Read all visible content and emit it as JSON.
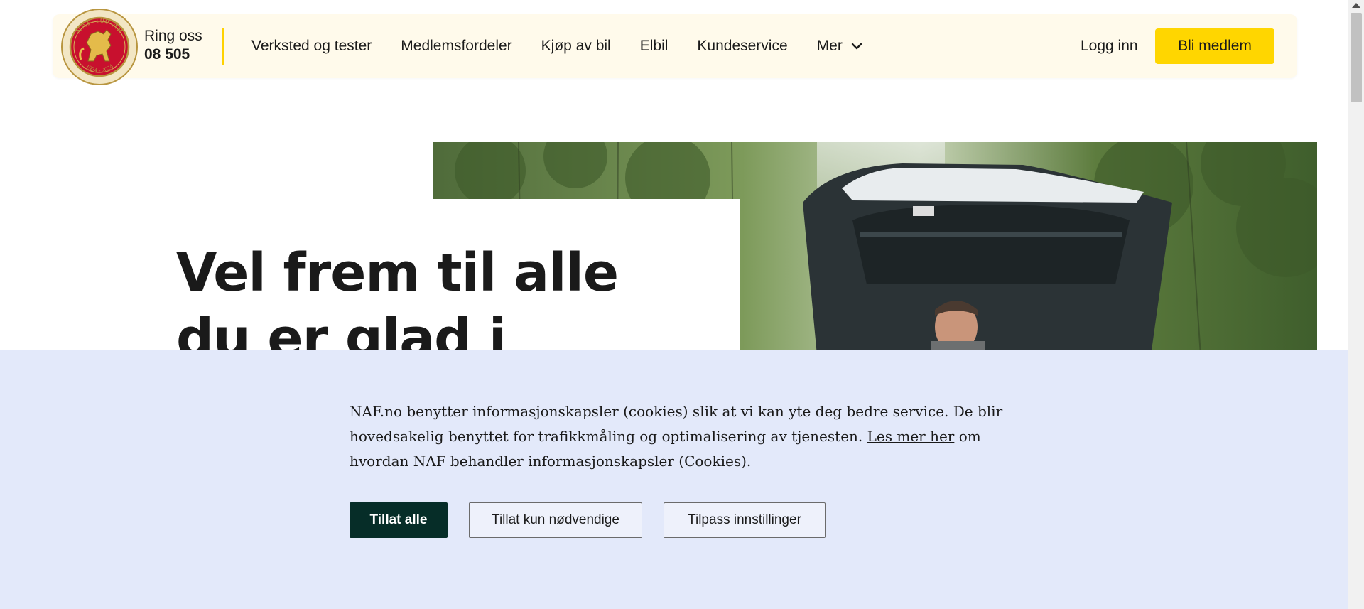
{
  "header": {
    "logo_text": "NAF 100 ÅR",
    "logo_years": "1924 - 2024",
    "call_label": "Ring oss",
    "call_number": "08 505",
    "nav": [
      {
        "label": "Verksted og tester"
      },
      {
        "label": "Medlemsfordeler"
      },
      {
        "label": "Kjøp av bil"
      },
      {
        "label": "Elbil"
      },
      {
        "label": "Kundeservice"
      },
      {
        "label": "Mer",
        "icon": "chevron-down-icon"
      }
    ],
    "login_label": "Logg inn",
    "join_label": "Bli medlem"
  },
  "hero": {
    "title": "Vel frem til alle du er glad i"
  },
  "cookie_banner": {
    "text_before_link": "NAF.no benytter informasjonskapsler (cookies) slik at vi kan yte deg bedre service. De blir hovedsakelig benyttet for trafikkmåling og optimalisering av tjenesten. ",
    "link_label": "Les mer her",
    "text_after_link": " om hvordan NAF behandler informasjonskapsler (Cookies).",
    "allow_all_label": "Tillat alle",
    "allow_necessary_label": "Tillat kun nødvendige",
    "customize_label": "Tilpass innstillinger"
  },
  "colors": {
    "header_bg": "#fffaeb",
    "brand_yellow": "#ffd600",
    "banner_bg": "#e3e9fa",
    "primary_button": "#062d28"
  }
}
